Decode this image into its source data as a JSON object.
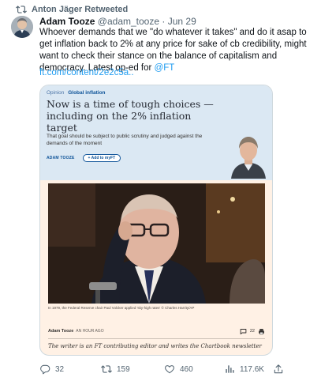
{
  "retweet": {
    "label": "Anton Jäger Retweeted"
  },
  "tweet": {
    "author_name": "Adam Tooze",
    "handle": "@adam_tooze",
    "separator": "·",
    "time": "Jun 29",
    "text": "Whoever demands that we \"do whatever it takes\" and do it asap to get inflation back to 2% at any price for sake of cb credibility, might want to check their stance on the balance of capitalism and democracy. Latest op-ed for ",
    "mention": "@FT",
    "link": "ft.com/content/2e2c5a.."
  },
  "card": {
    "section_label": "Opinion",
    "topic_label": "Global inflation",
    "headline": "Now is a time of tough choices — including on the 2% inflation target",
    "standfirst": "That goal should be subject to public scrutiny and judged against the demands of the moment",
    "byline_author": "ADAM TOOZE",
    "add_button": "+ Add to myFT",
    "caption": "In 1979, the Federal Reserve chair Paul Volcker applied 'sky-high rates' © Charles Harrity/AP",
    "meta_author": "Adam Tooze",
    "meta_time": "AN HOUR AGO",
    "comment_count": "22",
    "footnote": "The writer is an FT contributing editor and writes the Chartbook newsletter"
  },
  "actions": {
    "replies": "32",
    "retweets": "159",
    "likes": "460",
    "views": "117.6K"
  },
  "colors": {
    "link": "#1d9bf0",
    "ft_pink": "#fff1e5",
    "ft_blue": "#dbe8f3",
    "ft_claret": "#0f5499",
    "muted": "#536471"
  }
}
